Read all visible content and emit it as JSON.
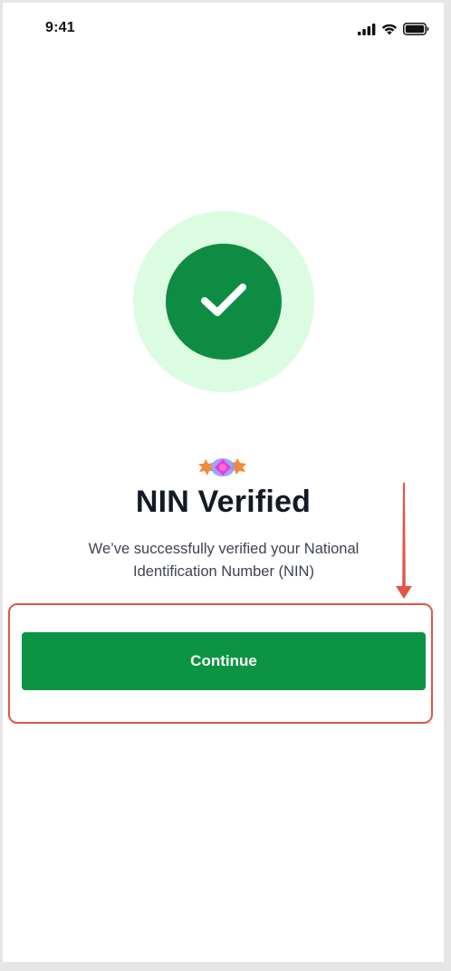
{
  "status_bar": {
    "time": "9:41",
    "icons": [
      "cellular-signal-icon",
      "wifi-icon",
      "battery-icon"
    ]
  },
  "success": {
    "icon": "checkmark-icon",
    "circle_color": "#0e8c44",
    "halo_color": "#dcfce2"
  },
  "content": {
    "title": "NIN Verified",
    "subtitle": "We’ve successfully verified your National Identification Number (NIN)"
  },
  "actions": {
    "continue_label": "Continue",
    "button_color": "#0c9444"
  },
  "annotation": {
    "color": "#e0564a"
  }
}
